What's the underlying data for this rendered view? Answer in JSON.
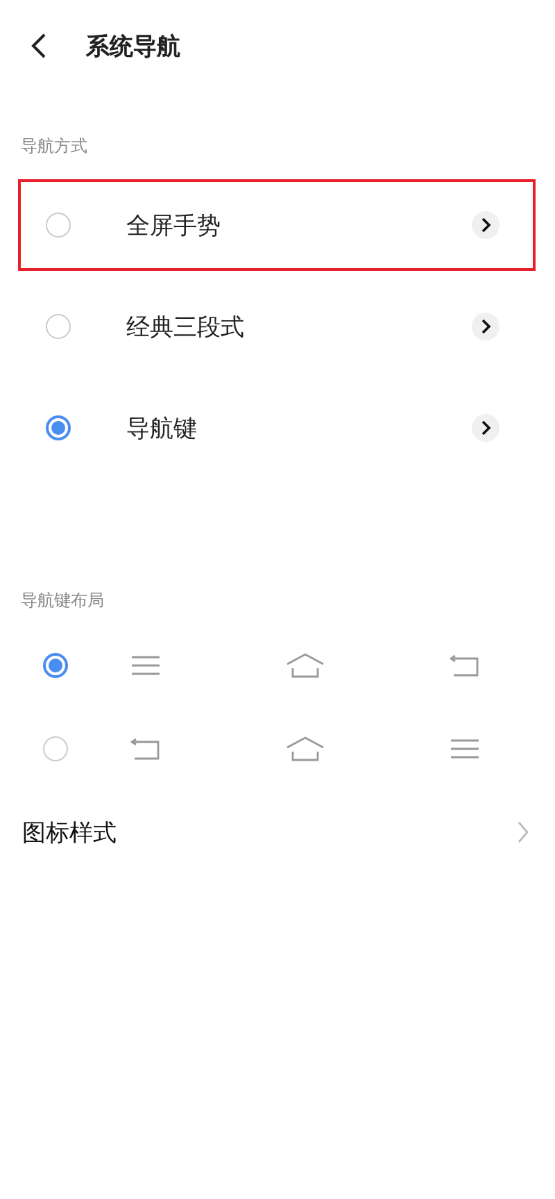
{
  "header": {
    "title": "系统导航"
  },
  "nav_mode": {
    "label": "导航方式",
    "options": [
      {
        "label": "全屏手势",
        "selected": false,
        "highlighted": true
      },
      {
        "label": "经典三段式",
        "selected": false,
        "highlighted": false
      },
      {
        "label": "导航键",
        "selected": true,
        "highlighted": false
      }
    ]
  },
  "key_layout": {
    "label": "导航键布局",
    "options": [
      {
        "selected": true,
        "keys": [
          {
            "kind": "menu"
          },
          {
            "kind": "home"
          },
          {
            "kind": "back"
          }
        ]
      },
      {
        "selected": false,
        "keys": [
          {
            "kind": "back"
          },
          {
            "kind": "home"
          },
          {
            "kind": "menu"
          }
        ]
      }
    ]
  },
  "icon_style": {
    "label": "图标样式"
  }
}
